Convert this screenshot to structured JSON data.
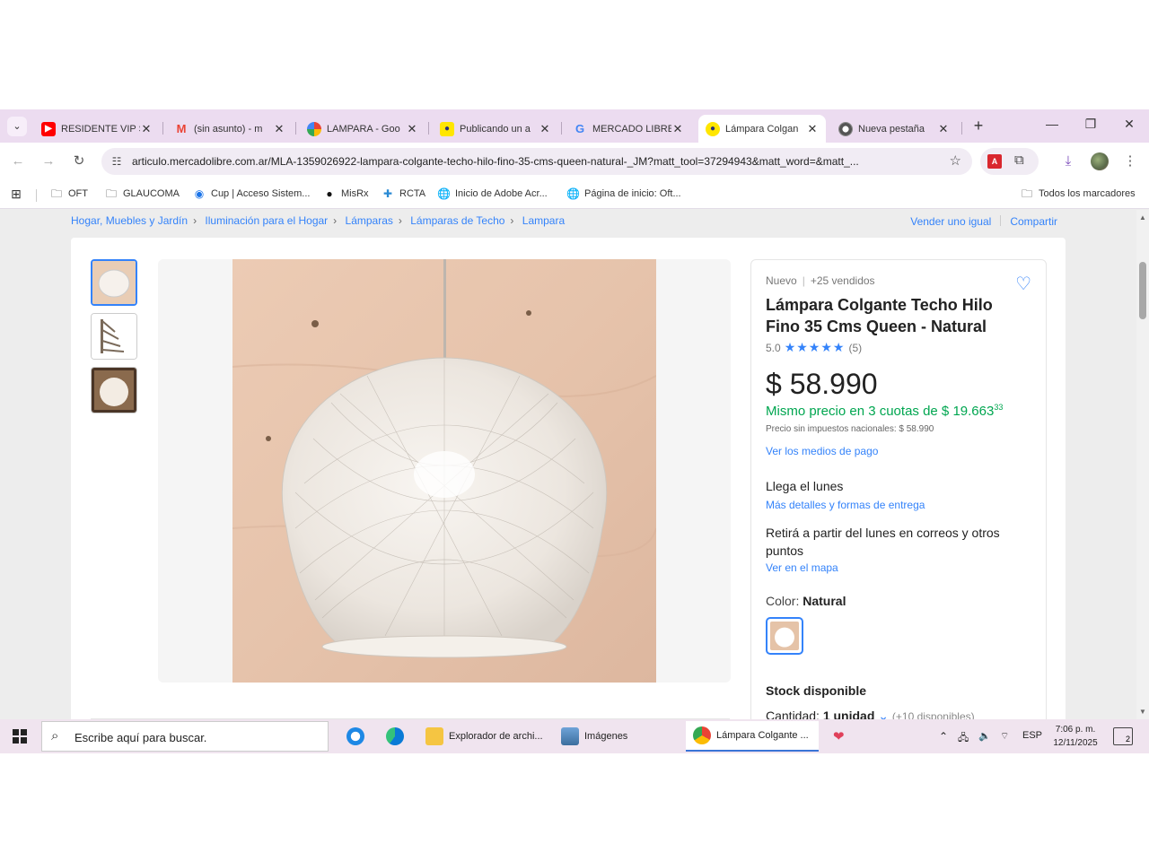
{
  "browser": {
    "tabs": [
      {
        "title": "RESIDENTE VIP S",
        "icon": "youtube-icon",
        "active": false
      },
      {
        "title": "(sin asunto) - m",
        "icon": "gmail-icon",
        "active": false
      },
      {
        "title": "LAMPARA - Goo",
        "icon": "photos-icon",
        "active": false
      },
      {
        "title": "Publicando un a",
        "icon": "mercadolibre-icon",
        "active": false
      },
      {
        "title": "MERCADO LIBRE",
        "icon": "google-icon",
        "active": false
      },
      {
        "title": "Lámpara Colgan",
        "icon": "mercadolibre-icon",
        "active": true
      },
      {
        "title": "Nueva pestaña",
        "icon": "chrome-icon",
        "active": false
      }
    ],
    "url": "articulo.mercadolibre.com.ar/MLA-1359026922-lampara-colgante-techo-hilo-fino-35-cms-queen-natural-_JM?matt_tool=37294943&matt_word=&matt_...",
    "bookmarks": [
      {
        "label": "OFT",
        "icon": "folder-icon"
      },
      {
        "label": "GLAUCOMA",
        "icon": "folder-icon"
      },
      {
        "label": "Cup | Acceso Sistem...",
        "icon": "cup-icon"
      },
      {
        "label": "MisRx",
        "icon": "misrx-icon"
      },
      {
        "label": "RCTA",
        "icon": "rcta-icon"
      },
      {
        "label": "Inicio de Adobe Acr...",
        "icon": "globe-icon"
      },
      {
        "label": "Página de inicio: Oft...",
        "icon": "globe-icon"
      }
    ],
    "all_bookmarks": "Todos los marcadores"
  },
  "page": {
    "breadcrumb": [
      "Hogar, Muebles y Jardín",
      "Iluminación para el Hogar",
      "Lámparas",
      "Lámparas de Techo",
      "Lampara"
    ],
    "sell_link": "Vender uno igual",
    "share_link": "Compartir",
    "condition": "Nuevo",
    "sold": "+25 vendidos",
    "title": "Lámpara Colgante Techo Hilo Fino 35 Cms Queen - Natural",
    "rating_value": "5.0",
    "rating_stars": 5,
    "rating_count": "(5)",
    "price": "$ 58.990",
    "installments_text": "Mismo precio en 3 cuotas de $ 19.663",
    "installments_cents": "33",
    "tax_note": "Precio sin impuestos nacionales: $ 58.990",
    "payment_link": "Ver los medios de pago",
    "shipping": "Llega el lunes",
    "shipping_link": "Más detalles y formas de entrega",
    "pickup": "Retirá a partir del lunes en correos y otros puntos",
    "map_link": "Ver en el mapa",
    "color_label": "Color:",
    "color_value": "Natural",
    "stock": "Stock disponible",
    "qty_label": "Cantidad:",
    "qty_value": "1 unidad",
    "qty_available": "(+10 disponibles)",
    "colors": {
      "accent": "#3483fa",
      "green": "#00a650"
    }
  },
  "taskbar": {
    "search_placeholder": "Escribe aquí para buscar.",
    "apps": [
      {
        "label": "Explorador de archi...",
        "icon": "file-explorer-icon"
      },
      {
        "label": "Imágenes",
        "icon": "images-icon"
      },
      {
        "label": "Lámpara Colgante ...",
        "icon": "chrome-icon"
      }
    ],
    "lang": "ESP",
    "time": "7:06 p. m.",
    "date": "12/11/2025",
    "notifications": "2"
  }
}
